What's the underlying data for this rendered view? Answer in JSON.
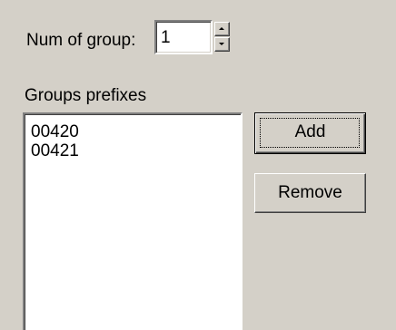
{
  "num_group": {
    "label": "Num of group:",
    "value": "1"
  },
  "groups_prefixes": {
    "label": "Groups prefixes",
    "items": [
      "00420",
      "00421"
    ]
  },
  "buttons": {
    "add_label": "Add",
    "remove_label": "Remove"
  }
}
